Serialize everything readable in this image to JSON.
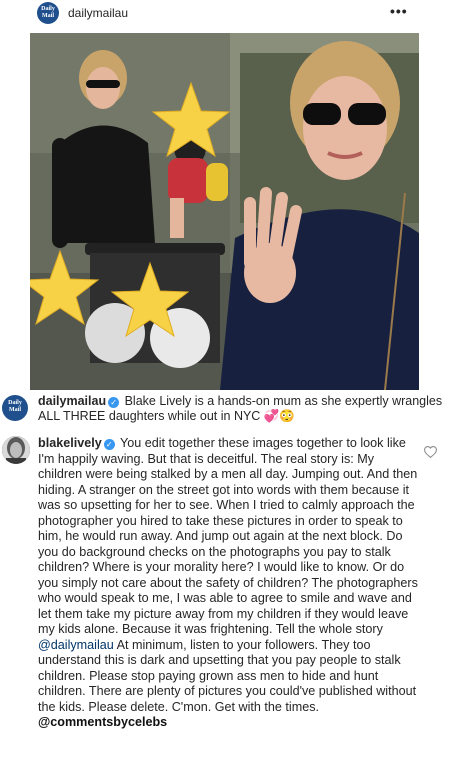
{
  "header": {
    "logo_text": "Daily Mail",
    "username": "dailymailau",
    "more_label": "•••"
  },
  "photo": {
    "sky_color": "#7a7f70",
    "left_woman_top_color": "#151515",
    "right_woman_top_color": "#182040",
    "hair_color": "#c9a46a",
    "star_color": "#f7d146"
  },
  "caption": {
    "logo_text": "Daily Mail",
    "username": "dailymailau",
    "text": "Blake Lively is a hands-on mum as she expertly wrangles ALL THREE daughters while out in NYC",
    "emojis": "💞😳"
  },
  "comment": {
    "username": "blakelively",
    "text_before_mention": "You edit together these images together to look like I'm happily waving. But that is deceitful. The real story is: My children were being stalked by a men all day. Jumping out. And then hiding. A stranger on the street got into words with them because it was so upsetting for her to see. When I tried to calmly approach the photographer you hired to take these pictures in order to speak to him, he would run away. And jump out again at the next block. Do you do background checks on the photographs you pay to stalk children? Where is your morality here? I would like to know. Or do you simply not care about the safety of children? The photographers who would speak to me, I was able to agree to smile and wave and let them take my picture away from my children if they would leave my kids alone. Because it was frightening. Tell the whole story",
    "mention": "@dailymailau",
    "text_after_mention": "At minimum, listen to your followers. They too understand this is dark and upsetting that you pay people to stalk children. Please stop paying grown ass men to hide and hunt children. There are plenty of pictures you could've published without the kids. Please delete. C'mon. Get with the times.",
    "watermark": "@commentsbycelebs",
    "like_icon": "heart-outline-icon"
  }
}
